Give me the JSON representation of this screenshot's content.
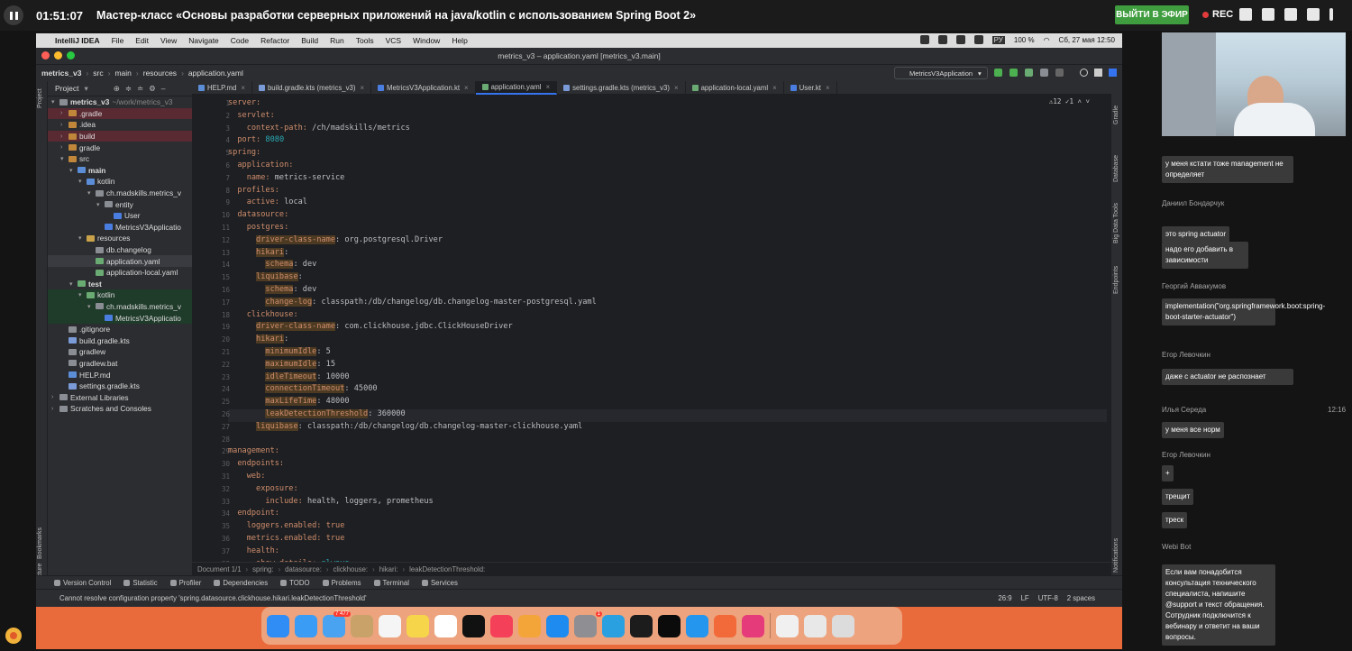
{
  "webinar": {
    "timer": "01:51:07",
    "title": "Мастер-класс «Основы разработки серверных приложений на java/kotlin с использованием Spring Boot 2»",
    "leave_button": "ВЫЙТИ В ЭФИР",
    "rec_label": "REC",
    "icons": [
      "chat-icon",
      "question-icon",
      "participants-icon",
      "files-icon",
      "more-icon"
    ]
  },
  "mac_menu": {
    "app": "IntelliJ IDEA",
    "items": [
      "File",
      "Edit",
      "View",
      "Navigate",
      "Code",
      "Refactor",
      "Build",
      "Run",
      "Tools",
      "VCS",
      "Window",
      "Help"
    ],
    "battery": "100 %",
    "input_lang": "РУ",
    "datetime": "Сб, 27 мая  12:50"
  },
  "ide": {
    "window_title": "metrics_v3 – application.yaml [metrics_v3.main]",
    "nav_path": [
      "metrics_v3",
      "src",
      "main",
      "resources",
      "application.yaml"
    ],
    "run_config": "MetricsV3Application",
    "project_label": "Project",
    "tree": [
      {
        "label": "metrics_v3",
        "extra": "~/work/metrics_v3",
        "depth": 0,
        "arrow": "▾",
        "bold": true,
        "icon": "#8a8d93"
      },
      {
        "label": ".gradle",
        "depth": 1,
        "arrow": "›",
        "icon": "#c0863a",
        "bg": "#5a2a33"
      },
      {
        "label": ".idea",
        "depth": 1,
        "arrow": "›",
        "icon": "#c0863a"
      },
      {
        "label": "build",
        "depth": 1,
        "arrow": "›",
        "icon": "#c0863a",
        "bg": "#5a2a33"
      },
      {
        "label": "gradle",
        "depth": 1,
        "arrow": "›",
        "icon": "#c0863a"
      },
      {
        "label": "src",
        "depth": 1,
        "arrow": "▾",
        "icon": "#c0863a"
      },
      {
        "label": "main",
        "depth": 2,
        "arrow": "▾",
        "icon": "#5c8ed8",
        "bold": true
      },
      {
        "label": "kotlin",
        "depth": 3,
        "arrow": "▾",
        "icon": "#5c8ed8"
      },
      {
        "label": "ch.madskills.metrics_v",
        "depth": 4,
        "arrow": "▾",
        "icon": "#8a8d93"
      },
      {
        "label": "entity",
        "depth": 5,
        "arrow": "▾",
        "icon": "#8a8d93"
      },
      {
        "label": "User",
        "depth": 6,
        "arrow": "",
        "icon": "#4a7de0"
      },
      {
        "label": "MetricsV3Applicatio",
        "depth": 5,
        "arrow": "",
        "icon": "#4a7de0"
      },
      {
        "label": "resources",
        "depth": 3,
        "arrow": "▾",
        "icon": "#c9a24a"
      },
      {
        "label": "db.changelog",
        "depth": 4,
        "arrow": "",
        "icon": "#8a8d93"
      },
      {
        "label": "application.yaml",
        "depth": 4,
        "arrow": "",
        "icon": "#6aab73",
        "bg": "#393b40"
      },
      {
        "label": "application-local.yaml",
        "depth": 4,
        "arrow": "",
        "icon": "#6aab73"
      },
      {
        "label": "test",
        "depth": 2,
        "arrow": "▾",
        "icon": "#6aab73",
        "bold": true
      },
      {
        "label": "kotlin",
        "depth": 3,
        "arrow": "▾",
        "icon": "#6aab73",
        "bg": "#1f3b2a"
      },
      {
        "label": "ch.madskills.metrics_v",
        "depth": 4,
        "arrow": "▾",
        "icon": "#8a8d93",
        "bg": "#1f3b2a"
      },
      {
        "label": "MetricsV3Applicatio",
        "depth": 5,
        "arrow": "",
        "icon": "#4a7de0",
        "bg": "#1f3b2a"
      },
      {
        "label": ".gitignore",
        "depth": 1,
        "arrow": "",
        "icon": "#8a8d93"
      },
      {
        "label": "build.gradle.kts",
        "depth": 1,
        "arrow": "",
        "icon": "#7a9ad8"
      },
      {
        "label": "gradlew",
        "depth": 1,
        "arrow": "",
        "icon": "#8a8d93"
      },
      {
        "label": "gradlew.bat",
        "depth": 1,
        "arrow": "",
        "icon": "#8a8d93"
      },
      {
        "label": "HELP.md",
        "depth": 1,
        "arrow": "",
        "icon": "#5c8ed8"
      },
      {
        "label": "settings.gradle.kts",
        "depth": 1,
        "arrow": "",
        "icon": "#7a9ad8"
      },
      {
        "label": "External Libraries",
        "depth": 0,
        "arrow": "›",
        "icon": "#8a8d93"
      },
      {
        "label": "Scratches and Consoles",
        "depth": 0,
        "arrow": "›",
        "icon": "#8a8d93"
      }
    ],
    "tabs": [
      {
        "label": "HELP.md",
        "icon": "#5c8ed8"
      },
      {
        "label": "build.gradle.kts (metrics_v3)",
        "icon": "#7a9ad8"
      },
      {
        "label": "MetricsV3Application.kt",
        "icon": "#4a7de0"
      },
      {
        "label": "application.yaml",
        "icon": "#6aab73",
        "active": true
      },
      {
        "label": "settings.gradle.kts (metrics_v3)",
        "icon": "#7a9ad8"
      },
      {
        "label": "application-local.yaml",
        "icon": "#6aab73"
      },
      {
        "label": "User.kt",
        "icon": "#4a7de0"
      }
    ],
    "inspections": "⚠12  ✓1  ˄  ˅",
    "code_lines": [
      [
        [
          "k",
          "server:"
        ]
      ],
      [
        [
          "t",
          "  "
        ],
        [
          "k",
          "servlet:"
        ]
      ],
      [
        [
          "t",
          "    "
        ],
        [
          "k",
          "context-path:"
        ],
        [
          "t",
          " /ch/madskills/metrics"
        ]
      ],
      [
        [
          "t",
          "  "
        ],
        [
          "k",
          "port:"
        ],
        [
          "t",
          " "
        ],
        [
          "n",
          "8080"
        ]
      ],
      [
        [
          "k",
          "spring:"
        ]
      ],
      [
        [
          "t",
          "  "
        ],
        [
          "k",
          "application:"
        ]
      ],
      [
        [
          "t",
          "    "
        ],
        [
          "k",
          "name:"
        ],
        [
          "t",
          " metrics-service"
        ]
      ],
      [
        [
          "t",
          "  "
        ],
        [
          "k",
          "profiles:"
        ]
      ],
      [
        [
          "t",
          "    "
        ],
        [
          "k",
          "active:"
        ],
        [
          "t",
          " local"
        ]
      ],
      [
        [
          "t",
          "  "
        ],
        [
          "k",
          "datasource:"
        ]
      ],
      [
        [
          "t",
          "    "
        ],
        [
          "k",
          "postgres:"
        ]
      ],
      [
        [
          "t",
          "      "
        ],
        [
          "h",
          "driver-class-name"
        ],
        [
          "t",
          ": org.postgresql.Driver"
        ]
      ],
      [
        [
          "t",
          "      "
        ],
        [
          "h",
          "hikari"
        ],
        [
          "t",
          ":"
        ]
      ],
      [
        [
          "t",
          "        "
        ],
        [
          "h",
          "schema"
        ],
        [
          "t",
          ": dev"
        ]
      ],
      [
        [
          "t",
          "      "
        ],
        [
          "h",
          "liquibase"
        ],
        [
          "t",
          ":"
        ]
      ],
      [
        [
          "t",
          "        "
        ],
        [
          "h",
          "schema"
        ],
        [
          "t",
          ": dev"
        ]
      ],
      [
        [
          "t",
          "        "
        ],
        [
          "h",
          "change-log"
        ],
        [
          "t",
          ": classpath:/db/changelog/db.changelog-master-postgresql.yaml"
        ]
      ],
      [
        [
          "t",
          "    "
        ],
        [
          "k",
          "clickhouse:"
        ]
      ],
      [
        [
          "t",
          "      "
        ],
        [
          "h",
          "driver-class-name"
        ],
        [
          "t",
          ": com.clickhouse.jdbc.ClickHouseDriver"
        ]
      ],
      [
        [
          "t",
          "      "
        ],
        [
          "h",
          "hikari"
        ],
        [
          "t",
          ":"
        ]
      ],
      [
        [
          "t",
          "        "
        ],
        [
          "h",
          "minimumIdle"
        ],
        [
          "t",
          ": 5"
        ]
      ],
      [
        [
          "t",
          "        "
        ],
        [
          "h",
          "maximumIdle"
        ],
        [
          "t",
          ": 15"
        ]
      ],
      [
        [
          "t",
          "        "
        ],
        [
          "h",
          "idleTimeout"
        ],
        [
          "t",
          ": 10000"
        ]
      ],
      [
        [
          "t",
          "        "
        ],
        [
          "h",
          "connectionTimeout"
        ],
        [
          "t",
          ": 45000"
        ]
      ],
      [
        [
          "t",
          "        "
        ],
        [
          "h",
          "maxLifeTime"
        ],
        [
          "t",
          ": 48000"
        ]
      ],
      [
        [
          "t",
          "        "
        ],
        [
          "h",
          "leakDetectionThreshold"
        ],
        [
          "t",
          ": 360000"
        ]
      ],
      [
        [
          "t",
          "      "
        ],
        [
          "h",
          "liquibase"
        ],
        [
          "t",
          ": classpath:/db/changelog/db.changelog-master-clickhouse.yaml"
        ]
      ],
      [
        [
          "t",
          ""
        ]
      ],
      [
        [
          "k",
          "management:"
        ]
      ],
      [
        [
          "t",
          "  "
        ],
        [
          "k",
          "endpoints:"
        ]
      ],
      [
        [
          "t",
          "    "
        ],
        [
          "k",
          "web:"
        ]
      ],
      [
        [
          "t",
          "      "
        ],
        [
          "k",
          "exposure:"
        ]
      ],
      [
        [
          "t",
          "        "
        ],
        [
          "k",
          "include:"
        ],
        [
          "t",
          " health, loggers, prometheus"
        ]
      ],
      [
        [
          "t",
          "  "
        ],
        [
          "k",
          "endpoint:"
        ]
      ],
      [
        [
          "t",
          "    "
        ],
        [
          "k",
          "loggers.enabled:"
        ],
        [
          "t",
          " "
        ],
        [
          "k",
          "true"
        ]
      ],
      [
        [
          "t",
          "    "
        ],
        [
          "k",
          "metrics.enabled:"
        ],
        [
          "t",
          " "
        ],
        [
          "k",
          "true"
        ]
      ],
      [
        [
          "t",
          "    "
        ],
        [
          "k",
          "health:"
        ]
      ],
      [
        [
          "t",
          "      "
        ],
        [
          "k",
          "show-details:"
        ],
        [
          "t",
          " "
        ],
        [
          "n",
          "always"
        ]
      ]
    ],
    "breadcrumbs": [
      "Document 1/1",
      "spring:",
      "datasource:",
      "clickhouse:",
      "hikari:",
      "leakDetectionThreshold:"
    ],
    "bottom_tools": [
      "Version Control",
      "Statistic",
      "Profiler",
      "Dependencies",
      "TODO",
      "Problems",
      "Terminal",
      "Services"
    ],
    "status_message": "Cannot resolve configuration property 'spring.datasource.clickhouse.hikari.leakDetectionThreshold'",
    "status_right": [
      "26:9",
      "LF",
      "UTF-8",
      "2 spaces"
    ],
    "left_strip": [
      "Project",
      "Bookmarks",
      "Structure"
    ],
    "right_strip": [
      "Gradle",
      "Database",
      "Big Data Tools",
      "Endpoints",
      "Notifications"
    ]
  },
  "dock": {
    "badges": {
      "mail": "7 477",
      "settings": "1"
    }
  },
  "chat": [
    {
      "type": "bubble",
      "text": "у меня кстати тоже management не определяет"
    },
    {
      "type": "author",
      "text": "Даниил Бондарчук"
    },
    {
      "type": "bubble",
      "text": "это spring actuator"
    },
    {
      "type": "bubble",
      "text": "надо его добавить в зависимости"
    },
    {
      "type": "author",
      "text": "Георгий Аввакумов"
    },
    {
      "type": "bubble",
      "text": "implementation(\"org.springframework.boot:spring-boot-starter-actuator\")"
    },
    {
      "type": "author",
      "text": "Егор Левочкин"
    },
    {
      "type": "bubble",
      "text": "даже с actuator не распознает"
    },
    {
      "type": "author",
      "text": "Илья Середа",
      "time": "12:16"
    },
    {
      "type": "bubble",
      "text": "у меня все норм"
    },
    {
      "type": "author",
      "text": "Егор Левочкин"
    },
    {
      "type": "bubble",
      "text": "+"
    },
    {
      "type": "bubble",
      "text": "трещит"
    },
    {
      "type": "bubble",
      "text": "треск"
    },
    {
      "type": "author",
      "text": "Webi Bot"
    },
    {
      "type": "bubble",
      "text": "Если вам понадобится консультация технического специалиста, напишите @support и текст обращения. Сотрудник подключится к вебинару и ответит на ваши вопросы."
    }
  ]
}
